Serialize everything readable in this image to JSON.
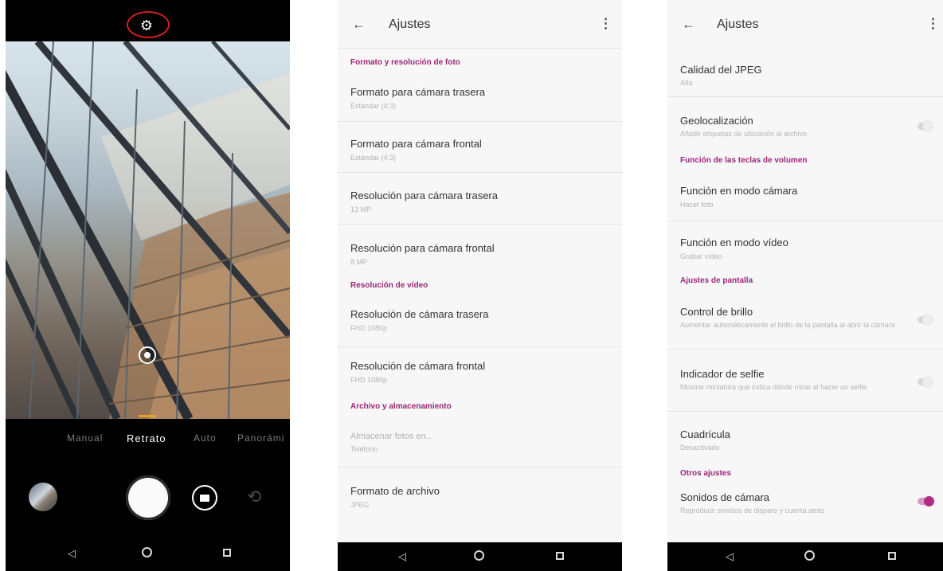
{
  "camera": {
    "modes": [
      "Manual",
      "Retrato",
      "Auto",
      "Panorámi"
    ],
    "active_mode": "Retrato",
    "icons": {
      "settings": "gear-icon",
      "focus": "focus-point-icon",
      "gallery": "gallery-thumbnail",
      "shutter": "shutter-button",
      "video": "video-camera-icon",
      "switch": "switch-camera-icon"
    },
    "annotation_color": "#d42020"
  },
  "nav": {
    "back": "◁",
    "home": "home-circle-icon",
    "recents": "recents-square-icon"
  },
  "settings_a": {
    "title": "Ajustes",
    "back_icon": "←",
    "menu_icon": "⋮",
    "sections": [
      {
        "header": "Formato y resolución de foto",
        "items": [
          {
            "title": "Formato para cámara trasera",
            "subtitle": "Estándar (4:3)"
          },
          {
            "title": "Formato para cámara frontal",
            "subtitle": "Estándar (4:3)"
          },
          {
            "title": "Resolución para cámara trasera",
            "subtitle": "13 MP"
          },
          {
            "title": "Resolución para cámara frontal",
            "subtitle": "8 MP"
          }
        ]
      },
      {
        "header": "Resolución de vídeo",
        "items": [
          {
            "title": "Resolución de cámara trasera",
            "subtitle": "FHD 1080p"
          },
          {
            "title": "Resolución de cámara frontal",
            "subtitle": "FHD 1080p"
          }
        ]
      },
      {
        "header": "Archivo y almacenamiento",
        "items": [
          {
            "title": "Almacenar fotos en...",
            "subtitle": "Teléfono",
            "disabled": true
          },
          {
            "title": "Formato de archivo",
            "subtitle": "JPEG"
          }
        ]
      }
    ]
  },
  "settings_b": {
    "title": "Ajustes",
    "back_icon": "←",
    "menu_icon": "⋮",
    "items": {
      "jpeg_quality": {
        "title": "Calidad del JPEG",
        "subtitle": "Alta"
      },
      "geolocation": {
        "title": "Geolocalización",
        "subtitle": "Añadir etiquetas de ubicación al archivo",
        "toggle_on": false
      },
      "volume_header": "Función de las teclas de volumen",
      "camera_mode": {
        "title": "Función en modo cámara",
        "subtitle": "Hacer foto"
      },
      "video_mode": {
        "title": "Función en modo vídeo",
        "subtitle": "Grabar vídeo"
      },
      "screen_header": "Ajustes de pantalla",
      "brightness": {
        "title": "Control de brillo",
        "subtitle": "Aumentar automáticamente el brillo de la pantalla al abrir la cámara",
        "toggle_on": false
      },
      "selfie": {
        "title": "Indicador de selfie",
        "subtitle": "Mostrar miniatura que indica dónde mirar al hacer un selfie",
        "toggle_on": false
      },
      "grid": {
        "title": "Cuadrícula",
        "subtitle": "Desactivado"
      },
      "other_header": "Otros ajustes",
      "sounds": {
        "title": "Sonidos de cámara",
        "subtitle": "Reproducir sonidos de disparo y cuenta atrás",
        "toggle_on": true
      }
    },
    "accent_color": "#9c2779"
  }
}
